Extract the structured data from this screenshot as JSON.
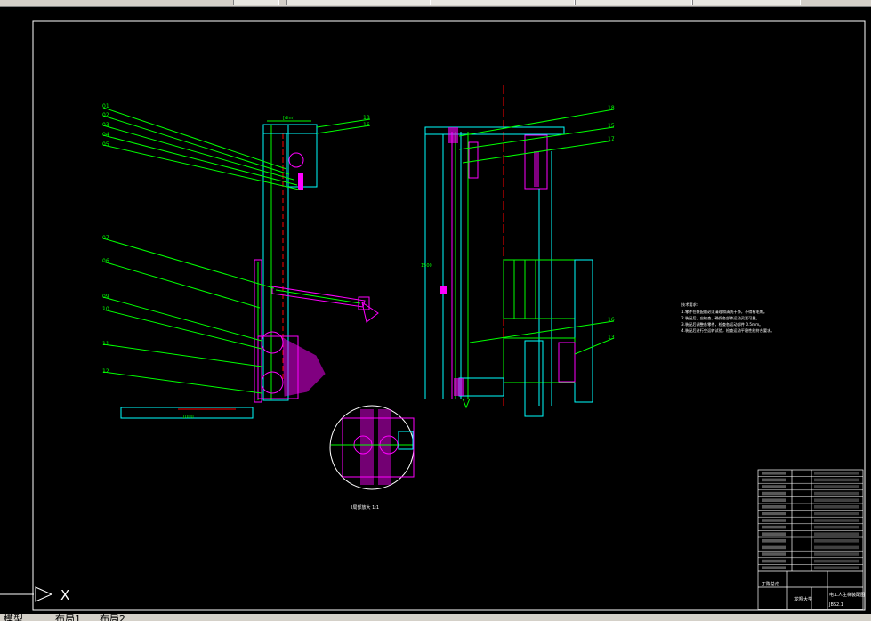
{
  "app": {
    "tabs": [
      "模型",
      "布局1",
      "布局2"
    ],
    "ucs_axis_label": "X"
  },
  "drawing": {
    "left_view_labels": [
      "01",
      "02",
      "03",
      "04",
      "05",
      "06",
      "07",
      "08",
      "09",
      "10",
      "11",
      "12"
    ],
    "right_view_labels": [
      "18",
      "15",
      "17",
      "16",
      "13"
    ],
    "top_right_labels": [
      "18",
      "16"
    ],
    "bottom_dims": "1000",
    "height_dim": "1500",
    "detail_caption": "I局部放大 1:1",
    "tech_notes_title": "技术要求:",
    "tech_notes": [
      "1.零件在装配前必须清理和清洗干净，不得有毛刺。",
      "2.装配后，应检查，确保各部件运动灵活可靠。",
      "3.装配后调整各零件，检查各运动部件 0.5mm。",
      "4.装配后进行空运转试验，检查运动平稳性能符合要求。"
    ]
  },
  "title_block": {
    "school": "龙翔大学",
    "drawing_name": "电工人生梯装配图",
    "drawing_no": "JBS2.1",
    "label_left": "丁陈总成",
    "parts_rows": [
      "",
      "",
      "",
      "",
      "",
      "",
      "",
      "",
      "",
      "",
      "",
      "",
      "",
      "",
      ""
    ]
  },
  "colors": {
    "background": "#000000",
    "frame": "#ffffff",
    "green": "#00ff00",
    "cyan": "#00ffff",
    "magenta": "#ff00ff",
    "red": "#ff0000",
    "yellow": "#ffff00"
  }
}
